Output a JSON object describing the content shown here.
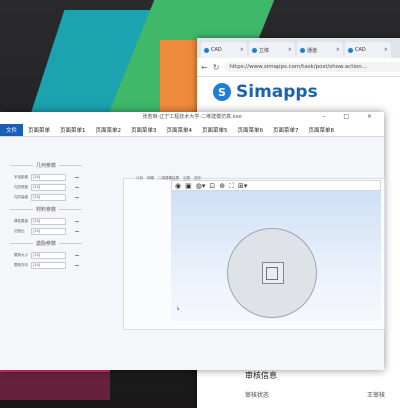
{
  "app": {
    "title": "张若琳-辽宁工程技术大学-二维建模仿真.exe",
    "menu": {
      "file": "文件",
      "pages": [
        "页面菜单",
        "页面菜单1",
        "页面菜单2",
        "页面菜单3",
        "页面菜单4",
        "页面菜单5",
        "页面菜单6",
        "页面菜单7",
        "页面菜单8"
      ]
    },
    "sections": [
      {
        "title": "几何参数",
        "params": [
          {
            "label": "半径距离",
            "value": "[20]"
          },
          {
            "label": "孔的宽度",
            "value": "[10]"
          },
          {
            "label": "孔的高度",
            "value": "[10]"
          }
        ]
      },
      {
        "title": "材料参数",
        "params": [
          {
            "label": "弹性模量",
            "value": "[10]"
          },
          {
            "label": "泊松比",
            "value": "[10]"
          }
        ]
      },
      {
        "title": "激励参数",
        "params": [
          {
            "label": "载荷大小",
            "value": "[10]"
          },
          {
            "label": "载荷方向",
            "value": "[10]"
          }
        ]
      }
    ],
    "viewer_tabs": [
      "几何",
      "网格",
      "二维建模结果",
      "云图",
      "变形"
    ]
  },
  "browser": {
    "tabs": [
      "CAD",
      "立体",
      "通道",
      "CAD"
    ],
    "url": "https://www.simapps.com/task/post/show.action...",
    "logo_text": "Simapps",
    "review_title": "审核信息",
    "review_status_label": "审核状态",
    "reviewer_label": "王审核"
  },
  "colors": {
    "file_button": "#1a5fb4",
    "brand": "#1b62b0"
  }
}
